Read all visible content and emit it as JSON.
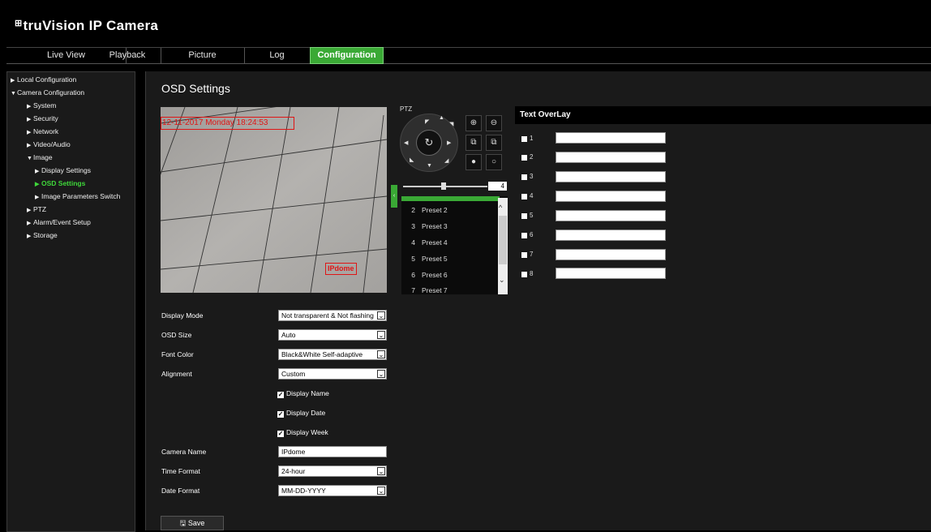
{
  "header": {
    "logo_mark": "⊞",
    "title": "truVision IP Camera"
  },
  "nav": {
    "tabs": [
      "Live View",
      "Playback",
      "Picture",
      "Log",
      "Configuration"
    ],
    "active": "Configuration"
  },
  "sidebar": {
    "items": [
      {
        "label": "Local Configuration"
      },
      {
        "label": "Camera Configuration"
      },
      {
        "label": "System"
      },
      {
        "label": "Security"
      },
      {
        "label": "Network"
      },
      {
        "label": "Video/Audio"
      },
      {
        "label": "Image"
      },
      {
        "label": "Display Settings"
      },
      {
        "label": "OSD Settings"
      },
      {
        "label": "Image Parameters Switch"
      },
      {
        "label": "PTZ"
      },
      {
        "label": "Alarm/Event Setup"
      },
      {
        "label": "Storage"
      }
    ]
  },
  "page": {
    "title": "OSD Settings"
  },
  "video": {
    "datetime_overlay": "12-11-2017 Monday 18:24:53",
    "camera_overlay": "IPdome"
  },
  "form": {
    "display_mode": {
      "label": "Display Mode",
      "value": "Not transparent & Not flashing"
    },
    "osd_size": {
      "label": "OSD Size",
      "value": "Auto"
    },
    "font_color": {
      "label": "Font Color",
      "value": "Black&White Self-adaptive"
    },
    "alignment": {
      "label": "Alignment",
      "value": "Custom"
    },
    "display_name": {
      "label": "Display Name",
      "checked": true
    },
    "display_date": {
      "label": "Display Date",
      "checked": true
    },
    "display_week": {
      "label": "Display Week",
      "checked": true
    },
    "camera_name": {
      "label": "Camera Name",
      "value": "IPdome"
    },
    "time_format": {
      "label": "Time Format",
      "value": "24-hour"
    },
    "date_format": {
      "label": "Date Format",
      "value": "MM-DD-YYYY"
    },
    "save_label": "Save"
  },
  "ptz": {
    "label": "PTZ",
    "speed": "4",
    "presets": [
      {
        "num": "2",
        "name": "Preset 2"
      },
      {
        "num": "3",
        "name": "Preset 3"
      },
      {
        "num": "4",
        "name": "Preset 4"
      },
      {
        "num": "5",
        "name": "Preset 5"
      },
      {
        "num": "6",
        "name": "Preset 6"
      },
      {
        "num": "7",
        "name": "Preset 7"
      }
    ]
  },
  "text_overlay": {
    "title": "Text OverLay",
    "rows": [
      "1",
      "2",
      "3",
      "4",
      "5",
      "6",
      "7",
      "8"
    ]
  },
  "colors": {
    "accent": "#3aa935",
    "active_sidebar": "#3fd83a",
    "overlay_red": "#e01515"
  }
}
